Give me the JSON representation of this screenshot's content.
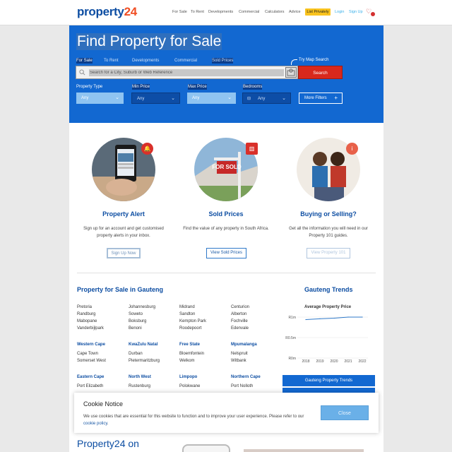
{
  "brand": {
    "logo_main": "property",
    "logo_accent": "24"
  },
  "nav": {
    "items": [
      "For Sale",
      "To Rent",
      "Developments",
      "Commercial",
      "Calculators",
      "Advice"
    ],
    "list_privately": "List Privately",
    "login": "Login",
    "signup": "Sign Up"
  },
  "hero": {
    "title": "Find Property for Sale",
    "tabs": [
      "For Sale",
      "To Rent",
      "Developments",
      "Commercial",
      "Sold Prices"
    ],
    "map_search": "Try Map Search",
    "search_placeholder": "Search for a City, Suburb or Web Reference",
    "search_button": "Search",
    "filters": [
      {
        "label": "Property Type",
        "value": "Any"
      },
      {
        "label": "Min Price",
        "value": "Any"
      },
      {
        "label": "Max Price",
        "value": "Any"
      },
      {
        "label": "Bedrooms",
        "value": "Any"
      }
    ],
    "more_filters": "More Filters"
  },
  "features": [
    {
      "title": "Property Alert",
      "desc": "Sign up for an account and get customised property alerts in your inbox.",
      "button": "Sign Up Now",
      "icon": "bell-icon"
    },
    {
      "title": "Sold Prices",
      "desc": "Find the value of any property in South Africa.",
      "button": "View Sold Prices",
      "icon": "chart-icon",
      "sign": "FOR SOLD"
    },
    {
      "title": "Buying or Selling?",
      "desc": "Get all the information you will need in our Property 101 guides.",
      "button": "View Property 101",
      "icon": "info-icon"
    }
  ],
  "gauteng": {
    "title": "Property for Sale in Gauteng",
    "columns": [
      [
        "Pretoria",
        "Randburg",
        "Mabopane",
        "Vanderbijlpark"
      ],
      [
        "Johannesburg",
        "Soweto",
        "Boksburg",
        "Benoni"
      ],
      [
        "Midrand",
        "Sandton",
        "Kempton Park",
        "Roodepoort"
      ],
      [
        "Centurion",
        "Alberton",
        "Fochville",
        "Edenvale"
      ]
    ],
    "regions": [
      {
        "name": "Western Cape",
        "cities": [
          "Cape Town",
          "Somerset West"
        ]
      },
      {
        "name": "KwaZulu Natal",
        "cities": [
          "Durban",
          "Pietermaritzburg"
        ]
      },
      {
        "name": "Free State",
        "cities": [
          "Bloemfontein",
          "Welkom"
        ]
      },
      {
        "name": "Mpumalanga",
        "cities": [
          "Nelspruit",
          "Witbank"
        ]
      },
      {
        "name": "Eastern Cape",
        "cities": [
          "Port Elizabeth"
        ]
      },
      {
        "name": "North West",
        "cities": [
          "Rustenburg"
        ]
      },
      {
        "name": "Limpopo",
        "cities": [
          "Polokwane"
        ]
      },
      {
        "name": "Northern Cape",
        "cities": [
          "Port Nolloth"
        ]
      }
    ]
  },
  "trends": {
    "title": "Gauteng Trends",
    "button": "Gauteng Property Trends"
  },
  "chart_data": {
    "type": "line",
    "title": "Average Property Price",
    "x": [
      "2018",
      "2019",
      "2020",
      "2021",
      "2022"
    ],
    "y_ticks": [
      "R1m",
      "R0.5m",
      "R0m"
    ],
    "ylim": [
      0,
      1000000
    ],
    "series": [
      {
        "values": [
          940000,
          960000,
          975000,
          1000000,
          1000000
        ]
      }
    ],
    "color": "#2f79c9"
  },
  "cookie": {
    "title": "Cookie Notice",
    "text": "We use cookies that are essential for this website to function and to improve your user experience. Please refer to our",
    "link": "cookie policy",
    "period": ".",
    "close": "Close"
  },
  "bottom": {
    "title": "Property24 on"
  }
}
